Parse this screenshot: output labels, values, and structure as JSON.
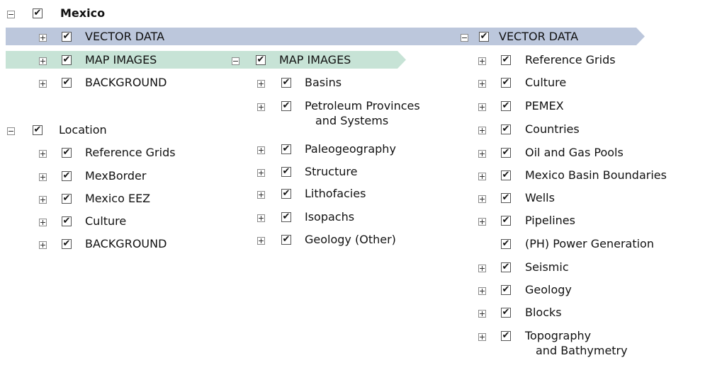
{
  "colors": {
    "vector_band": "#bcc7dc",
    "map_band": "#c7e3d6"
  },
  "icons": {
    "expanded": "minus-box-icon",
    "collapsed": "plus-box-icon",
    "checked": "checkbox-checked-icon"
  },
  "check_glyph": "✔",
  "left_tree": {
    "root": "Mexico",
    "items": [
      "VECTOR DATA",
      "MAP IMAGES",
      "BACKGROUND"
    ],
    "location": {
      "label": "Location",
      "items": [
        "Reference Grids",
        "MexBorder",
        "Mexico EEZ",
        "Culture",
        "BACKGROUND"
      ]
    }
  },
  "map_images": {
    "label": "MAP IMAGES",
    "items": [
      "Basins",
      "Petroleum Provinces",
      "Paleogeography",
      "Structure",
      "Lithofacies",
      "Isopachs",
      "Geology (Other)"
    ],
    "item_1_line2": "and Systems"
  },
  "vector_data": {
    "label": "VECTOR DATA",
    "items": [
      "Reference Grids",
      "Culture",
      "PEMEX",
      "Countries",
      "Oil and Gas Pools",
      "Mexico Basin Boundaries",
      "Wells",
      "Pipelines",
      "(PH) Power Generation",
      "Seismic",
      "Geology",
      "Blocks",
      "Topography"
    ],
    "item_12_line2": "and Bathymetry"
  }
}
